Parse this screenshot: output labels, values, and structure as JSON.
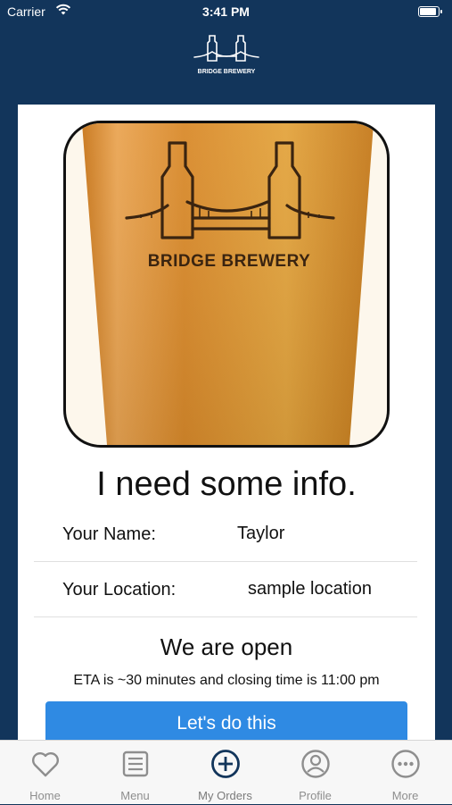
{
  "status_bar": {
    "carrier": "Carrier",
    "time": "3:41 PM"
  },
  "brand": {
    "name": "BRIDGE BREWERY"
  },
  "hero": {
    "logo_text": "BRIDGE BREWERY"
  },
  "form": {
    "title": "I need some info.",
    "name_label": "Your Name:",
    "name_value": "Taylor",
    "location_label": "Your Location:",
    "location_value": "sample location"
  },
  "status": {
    "open_text": "We are open",
    "eta_text": "ETA is ~30 minutes and closing time is 11:00 pm"
  },
  "cta": {
    "label": "Let's do this"
  },
  "tabs": [
    {
      "label": "Home",
      "icon": "heart-icon"
    },
    {
      "label": "Menu",
      "icon": "list-icon"
    },
    {
      "label": "My Orders",
      "icon": "plus-circle-icon"
    },
    {
      "label": "Profile",
      "icon": "person-circle-icon"
    },
    {
      "label": "More",
      "icon": "more-icon"
    }
  ],
  "colors": {
    "background": "#12355b",
    "accent": "#2f8ae3",
    "active_tab": "#12355b",
    "inactive_tab": "#8e8e8e"
  }
}
